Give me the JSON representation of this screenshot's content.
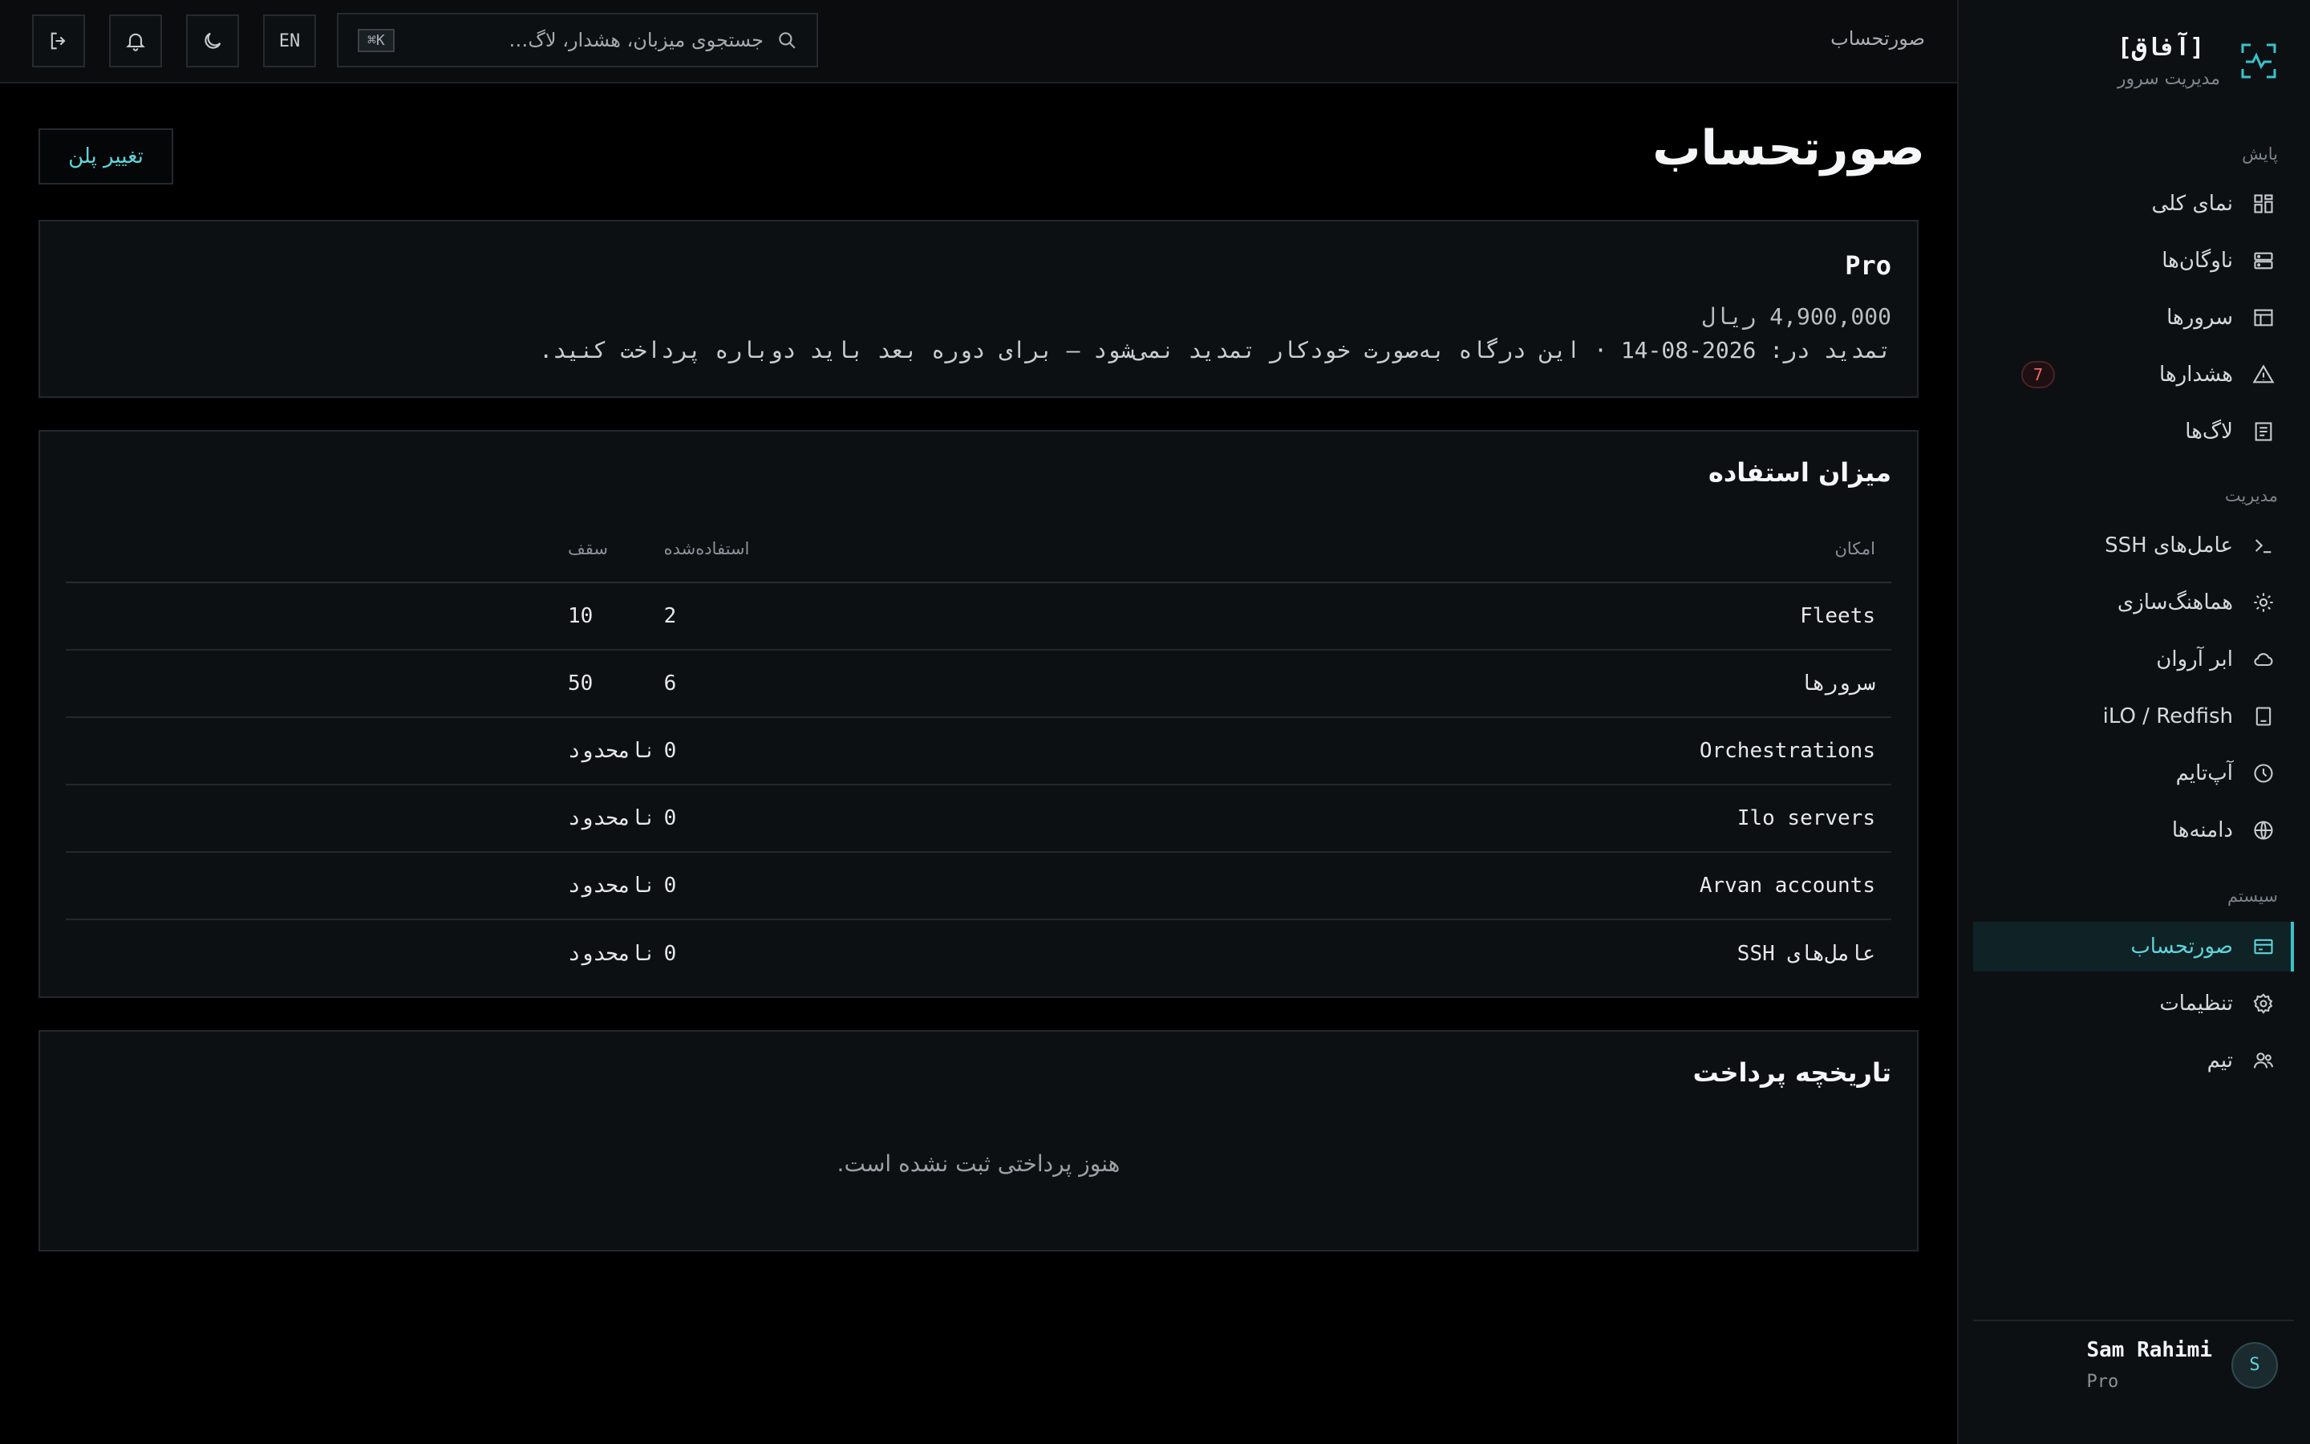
{
  "brand": {
    "title": "[آفاق]",
    "subtitle": "مدیریت سرور"
  },
  "colors": {
    "accent": "#39c3cb",
    "danger": "#f06a6a",
    "bg": "#000000",
    "panel": "#0d1013"
  },
  "sidebar": {
    "sections": [
      {
        "label": "پایش",
        "items": [
          {
            "label": "نمای کلی",
            "icon": "grid-icon"
          },
          {
            "label": "ناوگان‌ها",
            "icon": "server-rack-icon"
          },
          {
            "label": "سرورها",
            "icon": "table-icon"
          },
          {
            "label": "هشدارها",
            "icon": "warning-icon",
            "badge": "7"
          },
          {
            "label": "لاگ‌ها",
            "icon": "log-file-icon"
          }
        ]
      },
      {
        "label": "مدیریت",
        "items": [
          {
            "label": "عامل‌های SSH",
            "icon": "terminal-icon"
          },
          {
            "label": "هماهنگ‌سازی",
            "icon": "sun-gear-icon"
          },
          {
            "label": "ابر آروان",
            "icon": "cloud-icon"
          },
          {
            "label": "iLO / Redfish",
            "icon": "device-icon"
          },
          {
            "label": "آپ‌تایم",
            "icon": "clock-icon"
          },
          {
            "label": "دامنه‌ها",
            "icon": "globe-icon"
          }
        ]
      },
      {
        "label": "سیستم",
        "items": [
          {
            "label": "صورتحساب",
            "icon": "credit-card-icon",
            "active": true
          },
          {
            "label": "تنظیمات",
            "icon": "gear-icon"
          },
          {
            "label": "تیم",
            "icon": "users-icon"
          }
        ]
      }
    ],
    "user": {
      "initial": "S",
      "name": "Sam Rahimi",
      "plan": "Pro"
    }
  },
  "topbar": {
    "breadcrumb": "صورتحساب",
    "search_placeholder": "جستجوی میزبان، هشدار، لاگ…",
    "shortcut": "K⌘",
    "lang": "EN"
  },
  "page": {
    "title": "صورتحساب",
    "change_plan_label": "تغییر پلن"
  },
  "plan": {
    "name": "Pro",
    "price": "4,900,000 ریال",
    "renewal": "تمدید در: 2026-08-14 · این درگاه به‌صورت خودکار تمدید نمی‌شود — برای دوره بعد باید دوباره پرداخت کنید."
  },
  "usage": {
    "title": "میزان استفاده",
    "headers": {
      "feature": "امکان",
      "used": "استفاده‌شده",
      "cap": "سقف"
    },
    "rows": [
      {
        "feature": "Fleets",
        "used": "2",
        "cap": "10"
      },
      {
        "feature": "سرورها",
        "used": "6",
        "cap": "50"
      },
      {
        "feature": "Orchestrations",
        "used": "0",
        "cap": "نامحدود"
      },
      {
        "feature": "Ilo servers",
        "used": "0",
        "cap": "نامحدود"
      },
      {
        "feature": "Arvan accounts",
        "used": "0",
        "cap": "نامحدود"
      },
      {
        "feature": "عامل‌های SSH",
        "used": "0",
        "cap": "نامحدود"
      }
    ]
  },
  "history": {
    "title": "تاریخچه پرداخت",
    "empty": "هنوز پرداختی ثبت نشده است."
  }
}
